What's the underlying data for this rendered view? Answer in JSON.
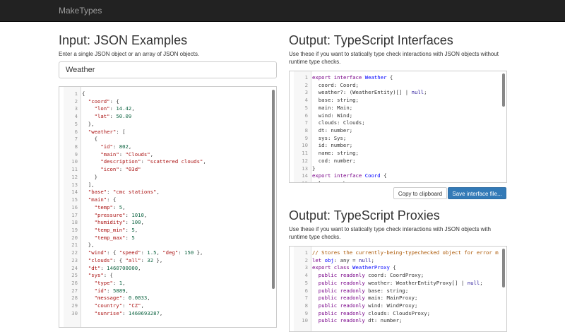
{
  "brand": "MakeTypes",
  "input": {
    "heading": "Input: JSON Examples",
    "help": "Enter a single JSON object or an array of JSON objects.",
    "name_value": "Weather",
    "lines": [
      "{",
      "  \"coord\": {",
      "    \"lon\": 14.42,",
      "    \"lat\": 50.09",
      "  },",
      "  \"weather\": [",
      "    {",
      "      \"id\": 802,",
      "      \"main\": \"Clouds\",",
      "      \"description\": \"scattered clouds\",",
      "      \"icon\": \"03d\"",
      "    }",
      "  ],",
      "  \"base\": \"cmc stations\",",
      "  \"main\": {",
      "    \"temp\": 5,",
      "    \"pressure\": 1010,",
      "    \"humidity\": 100,",
      "    \"temp_min\": 5,",
      "    \"temp_max\": 5",
      "  },",
      "  \"wind\": { \"speed\": 1.5, \"deg\": 150 },",
      "  \"clouds\": { \"all\": 32 },",
      "  \"dt\": 1460700000,",
      "  \"sys\": {",
      "    \"type\": 1,",
      "    \"id\": 5889,",
      "    \"message\": 0.0033,",
      "    \"country\": \"CZ\",",
      "    \"sunrise\": 1460693287,"
    ]
  },
  "interfaces": {
    "heading": "Output: TypeScript Interfaces",
    "help_line1": "Use these if you want to statically type check interactions with JSON objects without",
    "help_line2": "runtime type checks.",
    "lines": [
      "export interface Weather {",
      "  coord: Coord;",
      "  weather?: (WeatherEntity)[] | null;",
      "  base: string;",
      "  main: Main;",
      "  wind: Wind;",
      "  clouds: Clouds;",
      "  dt: number;",
      "  sys: Sys;",
      "  id: number;",
      "  name: string;",
      "  cod: number;",
      "}",
      "export interface Coord {",
      "  lon: number;"
    ],
    "copy_label": "Copy to clipboard",
    "save_label": "Save interface file..."
  },
  "proxies": {
    "heading": "Output: TypeScript Proxies",
    "help_line1": "Use these if you want to statically type check interactions with JSON objects with",
    "help_line2": "runtime type checks.",
    "lines": [
      "// Stores the currently-being-typechecked object for error m",
      "let obj: any = null;",
      "export class WeatherProxy {",
      "  public readonly coord: CoordProxy;",
      "  public readonly weather: WeatherEntityProxy[] | null;",
      "  public readonly base: string;",
      "  public readonly main: MainProxy;",
      "  public readonly wind: WindProxy;",
      "  public readonly clouds: CloudsProxy;",
      "  public readonly dt: number;"
    ]
  }
}
